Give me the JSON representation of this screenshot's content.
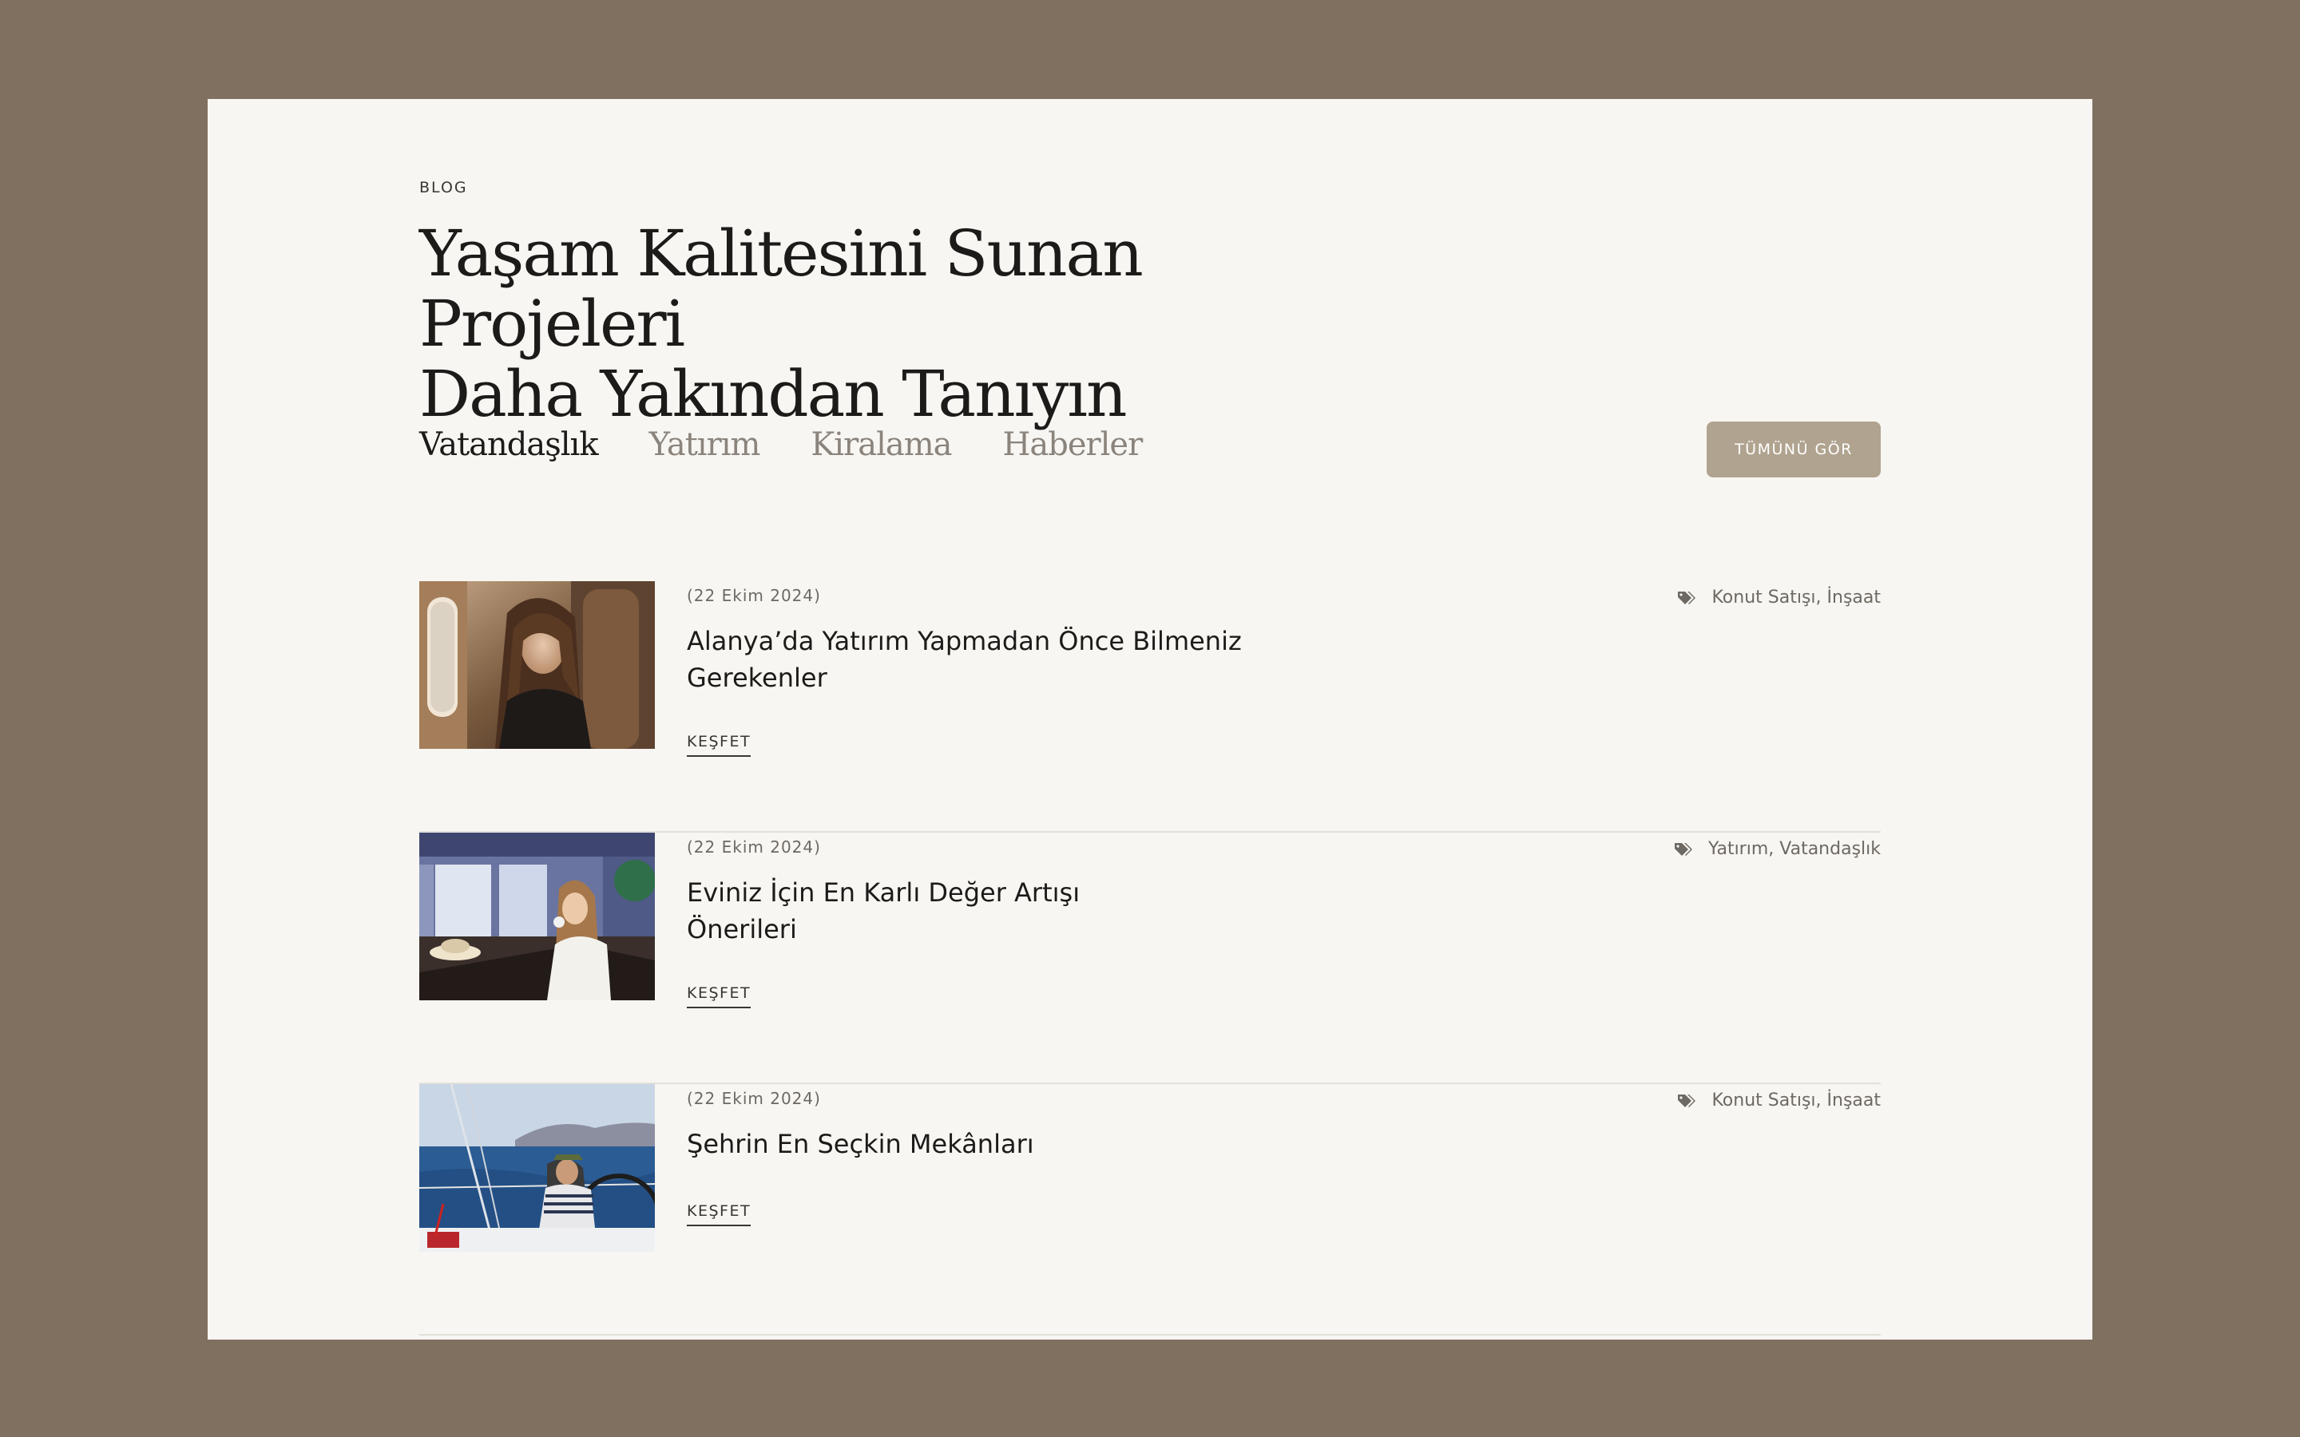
{
  "eyebrow": "BLOG",
  "title": {
    "line1": "Yaşam Kalitesini Sunan Projeleri",
    "line2": "Daha Yakından Tanıyın"
  },
  "tabs": [
    {
      "label": "Vatandaşlık",
      "active": true
    },
    {
      "label": "Yatırım",
      "active": false
    },
    {
      "label": "Kiralama",
      "active": false
    },
    {
      "label": "Haberler",
      "active": false
    }
  ],
  "view_all_label": "TÜMÜNÜ GÖR",
  "colors": {
    "page_bg": "#807060",
    "card_bg": "#f8f6f2",
    "accent_button": "#b0a38f",
    "divider": "#e3e0da"
  },
  "posts": [
    {
      "date": "(22 Ekim 2024)",
      "title_line1": "Alanya’da Yatırım Yapmadan Önce Bilmeniz",
      "title_line2": "Gerekenler",
      "explore_label": "KEŞFET",
      "tags": "Konut Satışı, İnşaat",
      "image": "woman-in-airplane-seat-photo"
    },
    {
      "date": "(22 Ekim 2024)",
      "title_line1": "Eviniz İçin En Karlı Değer Artışı",
      "title_line2": "Önerileri",
      "explore_label": "KEŞFET",
      "tags": "Yatırım, Vatandaşlık",
      "image": "woman-drinking-coffee-cafe-photo"
    },
    {
      "date": "(22 Ekim 2024)",
      "title_line1": "Şehrin En Seçkin Mekânları",
      "title_line2": "",
      "explore_label": "KEŞFET",
      "tags": "Konut Satışı, İnşaat",
      "image": "man-steering-sailboat-photo"
    }
  ],
  "icons": {
    "tag": "tag-icon"
  }
}
